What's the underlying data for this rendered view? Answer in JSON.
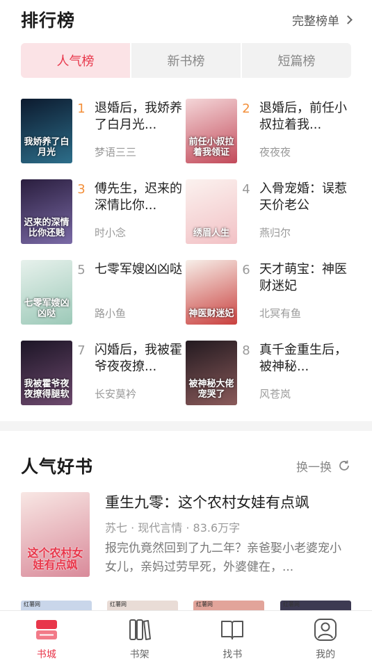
{
  "ranking": {
    "title": "排行榜",
    "full_list_label": "完整榜单",
    "tabs": [
      {
        "label": "人气榜",
        "active": true
      },
      {
        "label": "新书榜",
        "active": false
      },
      {
        "label": "短篇榜",
        "active": false
      }
    ],
    "items": [
      {
        "rank": "1",
        "title": "退婚后，我娇养了白月光...",
        "author": "梦语三三",
        "cover_text": "我娇养了白月光",
        "cover_colors": [
          "#0c1a2e",
          "#2d6e8a"
        ]
      },
      {
        "rank": "2",
        "title": "退婚后，前任小叔拉着我...",
        "author": "夜夜夜",
        "cover_text": "前任小叔拉着我领证",
        "cover_colors": [
          "#f4d6d8",
          "#c24a5a"
        ]
      },
      {
        "rank": "3",
        "title": "傅先生，迟来的深情比你...",
        "author": "时小念",
        "cover_text": "迟来的深情比你还贱",
        "cover_colors": [
          "#2a1e3e",
          "#7a6aa6"
        ]
      },
      {
        "rank": "4",
        "title": "入骨宠婚：误惹天价老公",
        "author": "燕归尔",
        "cover_text": "绣眉人生",
        "cover_colors": [
          "#fbf2ef",
          "#f2c1c5"
        ]
      },
      {
        "rank": "5",
        "title": "七零军嫂凶凶哒",
        "author": "路小鱼",
        "cover_text": "七零军嫂凶凶哒",
        "cover_colors": [
          "#e7f1ec",
          "#9cc9b8"
        ]
      },
      {
        "rank": "6",
        "title": "天才萌宝：神医财迷妃",
        "author": "北冥有鱼",
        "cover_text": "神医财迷妃",
        "cover_colors": [
          "#f7efe9",
          "#c9403e"
        ]
      },
      {
        "rank": "7",
        "title": "闪婚后，我被霍爷夜夜撩...",
        "author": "长安莫衿",
        "cover_text": "我被霍爷夜夜撩得腿软",
        "cover_colors": [
          "#1c1526",
          "#6e4a6e"
        ]
      },
      {
        "rank": "8",
        "title": "真千金重生后，被神秘...",
        "author": "风苍岚",
        "cover_text": "被神秘大佬宠哭了",
        "cover_colors": [
          "#231a20",
          "#8a5a5a"
        ]
      }
    ]
  },
  "popular": {
    "title": "人气好书",
    "refresh_label": "换一换",
    "feature": {
      "title": "重生九零：这个农村女娃有点飒",
      "meta": "苏七 · 现代言情 · 83.6万字",
      "description": "报完仇竟然回到了九二年？亲爸娶小老婆宠小女儿，亲妈过劳早死，外婆健在，...",
      "cover_text": "这个农村女娃有点飒",
      "cover_colors": [
        "#f8e7e4",
        "#d98a9a"
      ]
    },
    "peek_colors": [
      "#c9d6ea",
      "#e9dcd6",
      "#e2a49a",
      "#3d3a52"
    ],
    "peek_brand": "红薯网"
  },
  "nav": {
    "items": [
      {
        "label": "书城",
        "active": true
      },
      {
        "label": "书架",
        "active": false
      },
      {
        "label": "找书",
        "active": false
      },
      {
        "label": "我的",
        "active": false
      }
    ]
  },
  "colors": {
    "accent": "#e8364a",
    "rank_top": "#f38f3a"
  }
}
